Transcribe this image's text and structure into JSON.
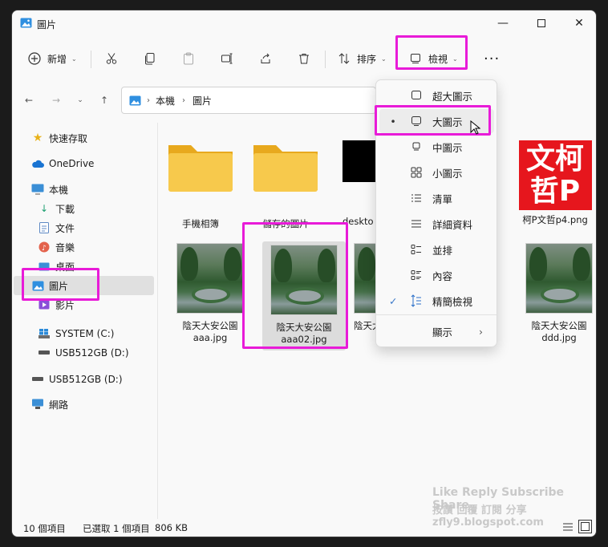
{
  "window": {
    "title": "圖片"
  },
  "toolbar": {
    "new": "新增",
    "sort": "排序",
    "view": "檢視"
  },
  "breadcrumb": {
    "root": "本機",
    "folder": "圖片"
  },
  "sidebar": {
    "items": [
      "快速存取",
      "OneDrive",
      "本機",
      "下載",
      "文件",
      "音樂",
      "桌面",
      "圖片",
      "影片",
      "SYSTEM (C:)",
      "USB512GB (D:)",
      "USB512GB (D:)",
      "網路"
    ]
  },
  "files": [
    {
      "name": "手機相簿",
      "kind": "folder"
    },
    {
      "name": "儲存的圖片",
      "kind": "folder"
    },
    {
      "name": "deskto",
      "kind": "black"
    },
    {
      "name": "柯P文哲p4.png",
      "kind": "logo"
    },
    {
      "name": "陰天大安公園 aaa.jpg",
      "kind": "photo"
    },
    {
      "name": "陰天大安公園 aaa02.jpg",
      "kind": "photo"
    },
    {
      "name": "陰天大 bb",
      "kind": "photo"
    },
    {
      "name": "陰天大安公園 ddd.jpg",
      "kind": "photo"
    }
  ],
  "logo": {
    "line1": "文柯",
    "line2": "哲P"
  },
  "view_menu": {
    "items": [
      "超大圖示",
      "大圖示",
      "中圖示",
      "小圖示",
      "清單",
      "詳細資料",
      "並排",
      "內容",
      "精簡檢視",
      "顯示"
    ],
    "selected_bullet": "•",
    "check": "✓"
  },
  "status": {
    "count": "10 個項目",
    "selected": "已選取 1 個項目",
    "size": "806 KB"
  },
  "watermark": {
    "line1": "Like Reply Subscribe Share",
    "line2": "按讚 回覆 訂閱 分享",
    "line3": "zfly9.blogspot.com"
  },
  "colors": {
    "highlight": "#e81bd8",
    "folder": "#f5c242",
    "logo_red": "#e6161d"
  }
}
